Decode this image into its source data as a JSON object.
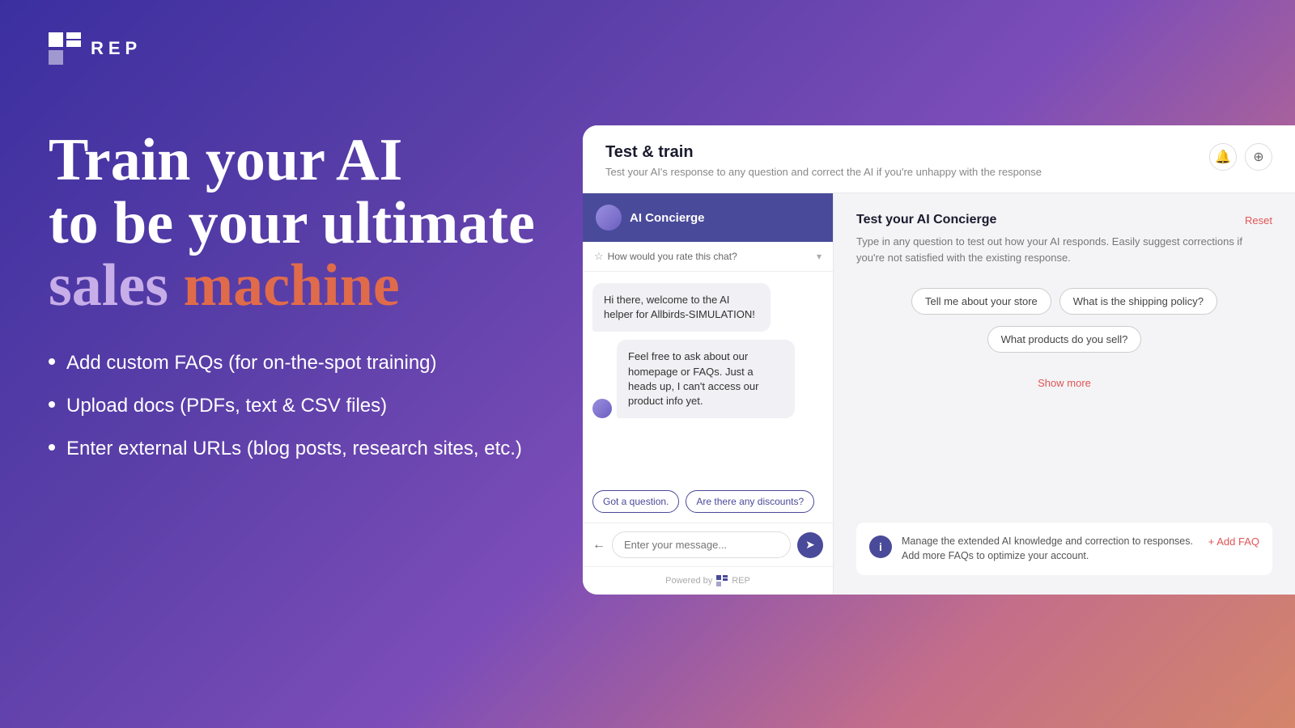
{
  "logo": {
    "text": "REP"
  },
  "hero": {
    "headline_line1": "Train your AI",
    "headline_line2": "to be your ultimate",
    "headline_sales": "sales",
    "headline_machine": "machine",
    "bullets": [
      "Add custom FAQs (for on-the-spot training)",
      "Upload docs (PDFs, text & CSV files)",
      "Enter external URLs (blog posts, research sites, etc.)"
    ]
  },
  "panel": {
    "header": {
      "title": "Test & train",
      "subtitle": "Test your AI's response to any question and correct the AI if you're unhappy with the response"
    },
    "chat": {
      "agent_name": "AI Concierge",
      "rating_text": "How would you rate this chat?",
      "messages": [
        "Hi there, welcome to the AI helper for Allbirds-SIMULATION!",
        "Feel free to ask about our homepage or FAQs. Just a heads up, I can't access our product info yet."
      ],
      "quick_replies": [
        "Got a question.",
        "Are there any discounts?"
      ],
      "input_placeholder": "Enter your message...",
      "powered_by": "Powered by",
      "powered_brand": "REP"
    },
    "test_section": {
      "title": "Test your AI Concierge",
      "reset_label": "Reset",
      "description": "Type in any question to test out how your AI responds. Easily suggest corrections if you're not satisfied with the existing response.",
      "suggestion_rows": [
        [
          "Tell me about your store",
          "What is the shipping policy?"
        ],
        [
          "What products do you sell?"
        ]
      ],
      "show_more": "Show more",
      "info_text": "Manage the extended AI knowledge and correction to responses. Add more FAQs to optimize your account.",
      "add_faq_label": "+ Add FAQ"
    }
  }
}
